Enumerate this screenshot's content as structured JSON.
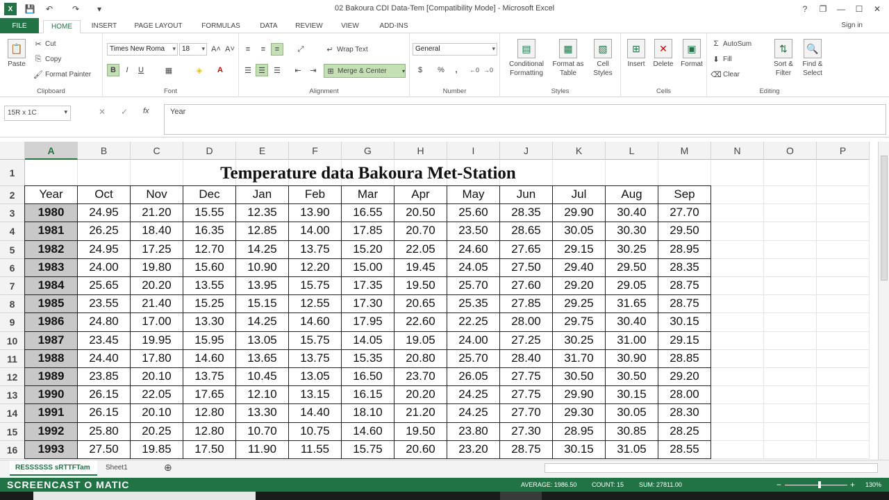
{
  "window": {
    "title": "02 Bakoura CDI Data-Tem  [Compatibility Mode] - Microsoft Excel",
    "help": "?",
    "restore": "❐",
    "minimize": "—",
    "maximize": "☐",
    "close": "✕"
  },
  "qat": {
    "excel_icon": "X",
    "save": "💾",
    "undo": "↶",
    "redo": "↷",
    "customize": "▾"
  },
  "tabs": [
    "FILE",
    "HOME",
    "INSERT",
    "PAGE LAYOUT",
    "FORMULAS",
    "DATA",
    "REVIEW",
    "VIEW",
    "ADD-INS"
  ],
  "signin": "Sign in",
  "ribbon": {
    "clipboard": {
      "label": "Clipboard",
      "paste": "Paste",
      "cut": "Cut",
      "copy": "Copy",
      "format_painter": "Format Painter"
    },
    "font": {
      "label": "Font",
      "name": "Times New Roma",
      "size": "18",
      "grow": "A˄",
      "shrink": "A˅",
      "bold": "B",
      "italic": "I",
      "underline": "U"
    },
    "alignment": {
      "label": "Alignment",
      "wrap": "Wrap Text",
      "merge": "Merge & Center"
    },
    "number": {
      "label": "Number",
      "format": "General",
      "currency": "$",
      "percent": "%",
      "comma": ","
    },
    "styles": {
      "label": "Styles",
      "conditional": "Conditional Formatting",
      "format_table": "Format as Table",
      "cell_styles": "Cell Styles"
    },
    "cells": {
      "label": "Cells",
      "insert": "Insert",
      "delete": "Delete",
      "format": "Format"
    },
    "editing": {
      "label": "Editing",
      "autosum": "AutoSum",
      "fill": "Fill",
      "clear": "Clear",
      "sort": "Sort & Filter",
      "find": "Find & Select"
    }
  },
  "formula_bar": {
    "namebox": "15R x 1C",
    "cancel": "✕",
    "enter": "✓",
    "fx": "fx",
    "value": "Year"
  },
  "sheet": {
    "columns": [
      "A",
      "B",
      "C",
      "D",
      "E",
      "F",
      "G",
      "H",
      "I",
      "J",
      "K",
      "L",
      "M",
      "N",
      "O",
      "P"
    ],
    "rows": [
      "1",
      "2",
      "3",
      "4",
      "5",
      "6",
      "7",
      "8",
      "9",
      "10",
      "11",
      "12",
      "13",
      "14",
      "15",
      "16"
    ],
    "title": "Temperature data Bakoura Met-Station",
    "headers": [
      "Year",
      "Oct",
      "Nov",
      "Dec",
      "Jan",
      "Feb",
      "Mar",
      "Apr",
      "May",
      "Jun",
      "Jul",
      "Aug",
      "Sep"
    ],
    "data": [
      [
        "1980",
        "24.95",
        "21.20",
        "15.55",
        "12.35",
        "13.90",
        "16.55",
        "20.50",
        "25.60",
        "28.35",
        "29.90",
        "30.40",
        "27.70"
      ],
      [
        "1981",
        "26.25",
        "18.40",
        "16.35",
        "12.85",
        "14.00",
        "17.85",
        "20.70",
        "23.50",
        "28.65",
        "30.05",
        "30.30",
        "29.50"
      ],
      [
        "1982",
        "24.95",
        "17.25",
        "12.70",
        "14.25",
        "13.75",
        "15.20",
        "22.05",
        "24.60",
        "27.65",
        "29.15",
        "30.25",
        "28.95"
      ],
      [
        "1983",
        "24.00",
        "19.80",
        "15.60",
        "10.90",
        "12.20",
        "15.00",
        "19.45",
        "24.05",
        "27.50",
        "29.40",
        "29.50",
        "28.35"
      ],
      [
        "1984",
        "25.65",
        "20.20",
        "13.55",
        "13.95",
        "15.75",
        "17.35",
        "19.50",
        "25.70",
        "27.60",
        "29.20",
        "29.05",
        "28.75"
      ],
      [
        "1985",
        "23.55",
        "21.40",
        "15.25",
        "15.15",
        "12.55",
        "17.30",
        "20.65",
        "25.35",
        "27.85",
        "29.25",
        "31.65",
        "28.75"
      ],
      [
        "1986",
        "24.80",
        "17.00",
        "13.30",
        "14.25",
        "14.60",
        "17.95",
        "22.60",
        "22.25",
        "28.00",
        "29.75",
        "30.40",
        "30.15"
      ],
      [
        "1987",
        "23.45",
        "19.95",
        "15.95",
        "13.05",
        "15.75",
        "14.05",
        "19.05",
        "24.00",
        "27.25",
        "30.25",
        "31.00",
        "29.15"
      ],
      [
        "1988",
        "24.40",
        "17.80",
        "14.60",
        "13.65",
        "13.75",
        "15.35",
        "20.80",
        "25.70",
        "28.40",
        "31.70",
        "30.90",
        "28.85"
      ],
      [
        "1989",
        "23.85",
        "20.10",
        "13.75",
        "10.45",
        "13.05",
        "16.50",
        "23.70",
        "26.05",
        "27.75",
        "30.50",
        "30.50",
        "29.20"
      ],
      [
        "1990",
        "26.15",
        "22.05",
        "17.65",
        "12.10",
        "13.15",
        "16.15",
        "20.20",
        "24.25",
        "27.75",
        "29.90",
        "30.15",
        "28.00"
      ],
      [
        "1991",
        "26.15",
        "20.10",
        "12.80",
        "13.30",
        "14.40",
        "18.10",
        "21.20",
        "24.25",
        "27.70",
        "29.30",
        "30.05",
        "28.30"
      ],
      [
        "1992",
        "25.80",
        "20.25",
        "12.80",
        "10.70",
        "10.75",
        "14.60",
        "19.50",
        "23.80",
        "27.30",
        "28.95",
        "30.85",
        "28.25"
      ],
      [
        "1993",
        "27.50",
        "19.85",
        "17.50",
        "11.90",
        "11.55",
        "15.75",
        "20.60",
        "23.20",
        "28.75",
        "30.15",
        "31.05",
        "28.55"
      ]
    ]
  },
  "sheet_tabs": [
    "Sheet1"
  ],
  "active_tab_label": "RESSSSSS sRTTFTam",
  "status": {
    "watermark": "SCREENCAST O MATIC",
    "average": "AVERAGE: 1986.50",
    "count": "COUNT: 15",
    "sum": "SUM: 27811.00",
    "zoom": "130%"
  },
  "colors": {
    "excel_green": "#217346",
    "year_fill": "#c8c8c8"
  }
}
